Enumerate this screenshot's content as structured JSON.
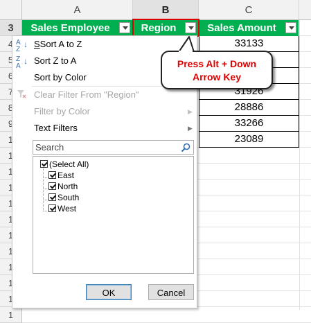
{
  "columns": [
    "A",
    "B",
    "C"
  ],
  "row_numbers": [
    "3",
    "4",
    "5",
    "6",
    "7",
    "8",
    "9",
    "1",
    "1",
    "1",
    "1",
    "1",
    "1",
    "1",
    "1",
    "1",
    "1",
    "1",
    "1"
  ],
  "header_cells": {
    "sales_employee": "Sales Employee",
    "region": "Region",
    "sales_amount": "Sales Amount"
  },
  "sales_amounts": [
    "33133",
    "",
    "",
    "31926",
    "28886",
    "33266",
    "23089"
  ],
  "menu": {
    "sort_a_to_z": "Sort A to Z",
    "sort_z_to_a": "Sort Z to A",
    "sort_by_color": "Sort by Color",
    "clear_filter": "Clear Filter From \"Region\"",
    "filter_by_color": "Filter by Color",
    "text_filters": "Text Filters",
    "search_placeholder": "Search",
    "sort_az_icon_top": "A",
    "sort_az_icon_bottom": "Z",
    "sort_za_icon_top": "Z",
    "sort_za_icon_bottom": "A"
  },
  "filter_values": [
    {
      "label": "(Select All)",
      "checked": true
    },
    {
      "label": "East",
      "checked": true
    },
    {
      "label": "North",
      "checked": true
    },
    {
      "label": "South",
      "checked": true
    },
    {
      "label": "West",
      "checked": true
    }
  ],
  "buttons": {
    "ok": "OK",
    "cancel": "Cancel"
  },
  "callout": {
    "line1": "Press Alt + Down",
    "line2": "Arrow Key"
  },
  "colors": {
    "header_green": "#00b050",
    "highlight_red": "#e00000"
  }
}
